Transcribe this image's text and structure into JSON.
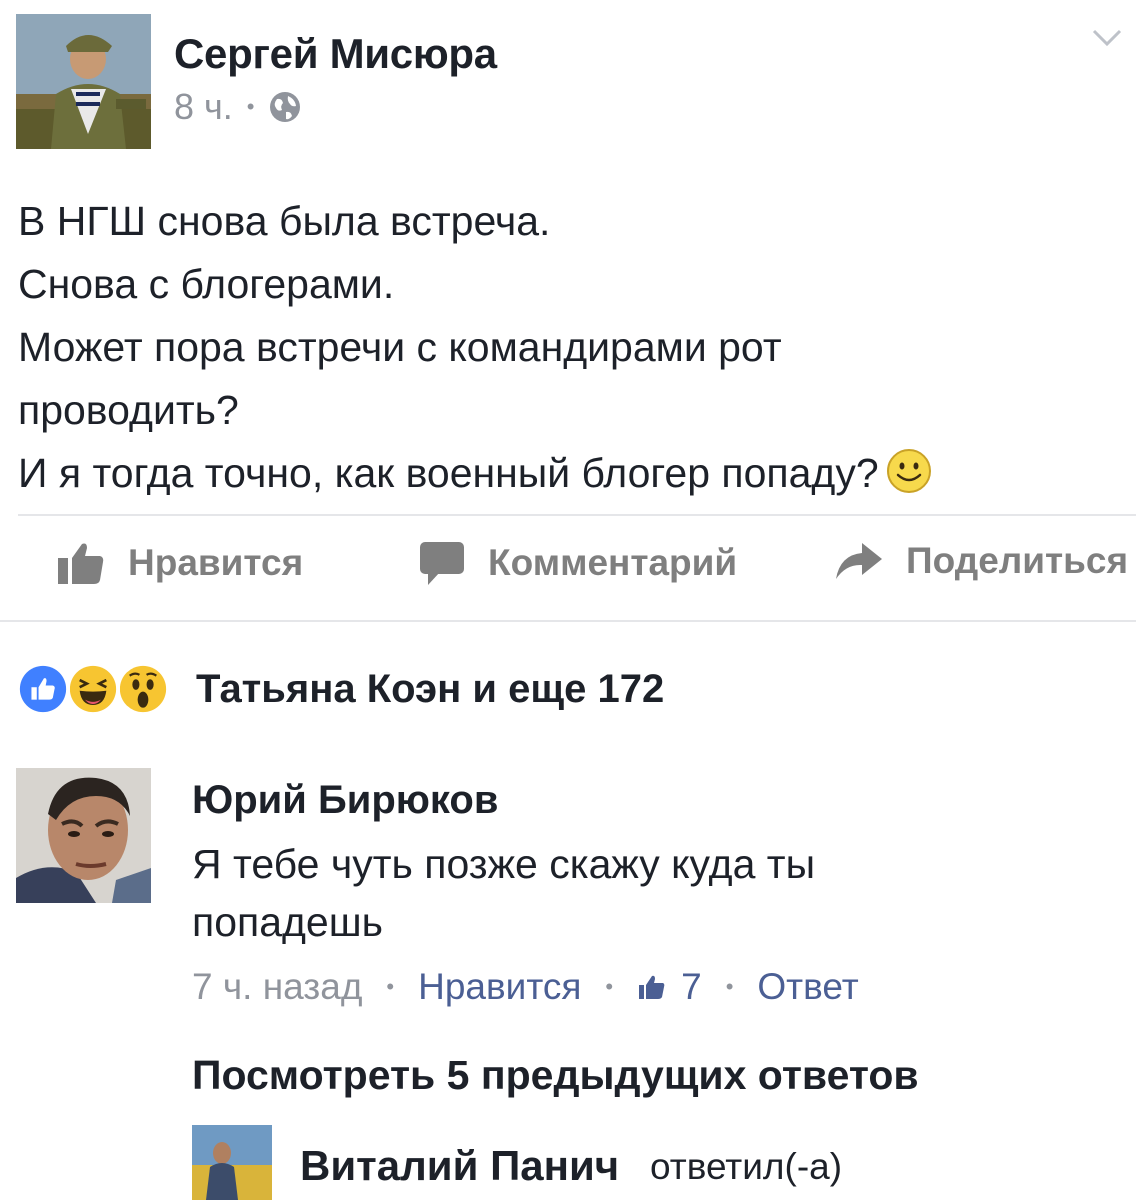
{
  "post": {
    "author": "Сергей Мисюра",
    "time": "8 ч.",
    "dot": "•",
    "lines": [
      "В НГШ снова была встреча.",
      "Снова с блогерами.",
      "Может пора встречи с командирами рот",
      "проводить?",
      "И я тогда точно, как военный блогер попаду?"
    ]
  },
  "actions": {
    "like": "Нравится",
    "comment": "Комментарий",
    "share": "Поделиться"
  },
  "reactions": {
    "summary": "Татьяна Коэн и еще 172"
  },
  "comment": {
    "author": "Юрий Бирюков",
    "text_line1": "Я тебе чуть позже скажу куда ты",
    "text_line2": "попадешь",
    "time": "7 ч. назад",
    "like": "Нравится",
    "like_count": "7",
    "reply": "Ответ",
    "sep": "•"
  },
  "replies": {
    "view_previous": "Посмотреть 5 предыдущих ответов",
    "reply_author": "Виталий Панич",
    "reply_suffix": "ответил(-а)"
  },
  "colors": {
    "text": "#1d2129",
    "meta": "#90949c",
    "action_gray": "#7f7f7f",
    "link": "#4b5f94",
    "like_blue": "#4080ff",
    "emoji_yellow": "#f7c531"
  }
}
